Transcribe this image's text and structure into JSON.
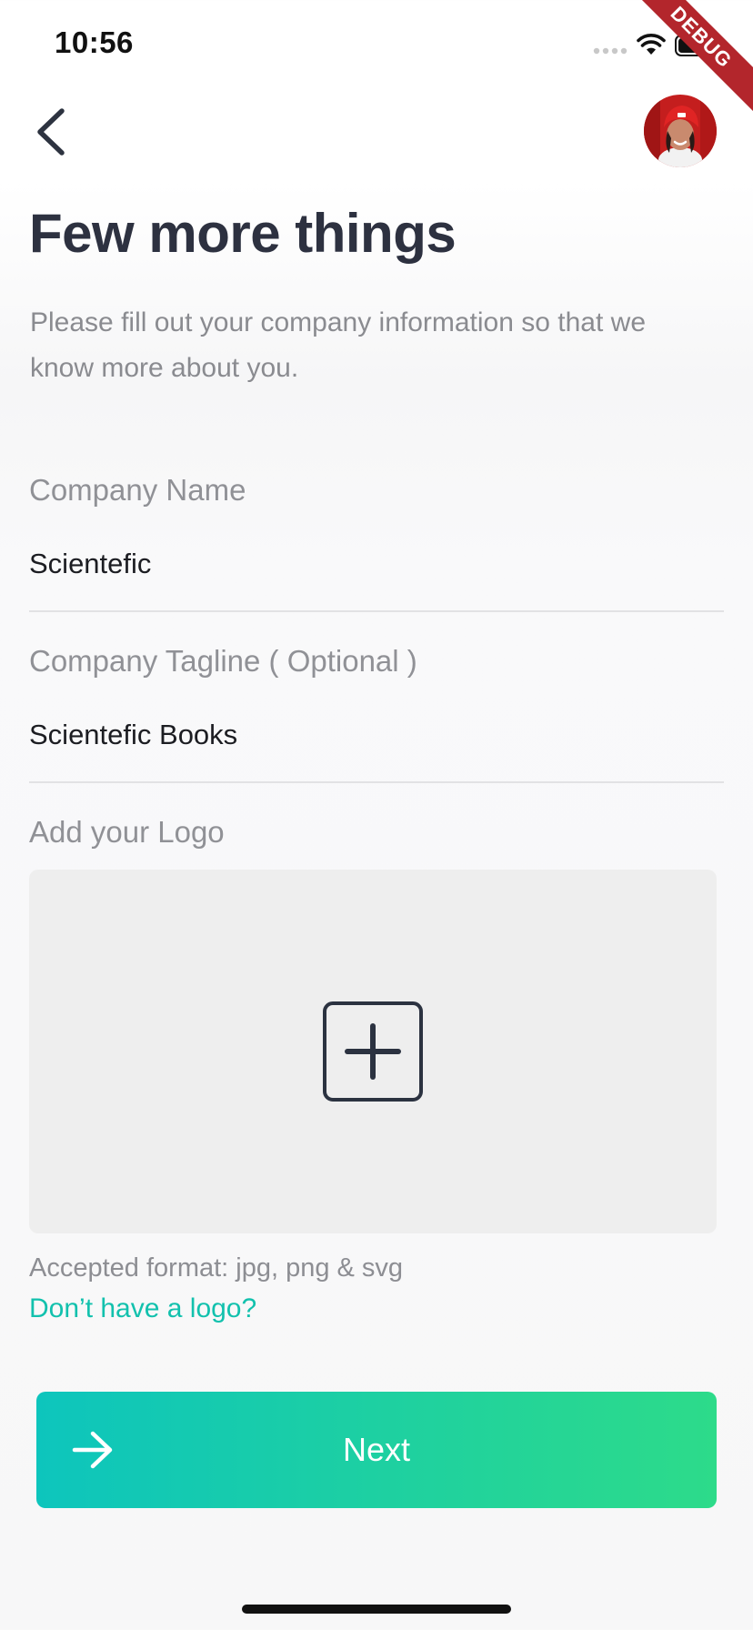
{
  "status_bar": {
    "time": "10:56",
    "debug_label": "DEBUG"
  },
  "header": {
    "back_icon": "chevron-left-icon",
    "avatar_icon": "user-avatar"
  },
  "main": {
    "title": "Few more things",
    "subtitle": "Please fill out your company information so that we know more about you.",
    "company_name": {
      "label": "Company Name",
      "value": "Scientefic"
    },
    "company_tagline": {
      "label": "Company Tagline ( Optional )",
      "value": "Scientefic Books"
    },
    "logo": {
      "label": "Add your Logo",
      "add_icon": "plus-square-icon",
      "format_note": "Accepted format: jpg, png & svg",
      "no_logo_link": "Don’t have a logo?"
    },
    "next_button": {
      "label": "Next",
      "icon": "arrow-right-icon"
    }
  },
  "colors": {
    "accent": "#12c1ad",
    "gradient_start": "#0dc5bd",
    "gradient_end": "#2ddb8a",
    "title": "#2d3140",
    "debug": "#b3262c"
  }
}
